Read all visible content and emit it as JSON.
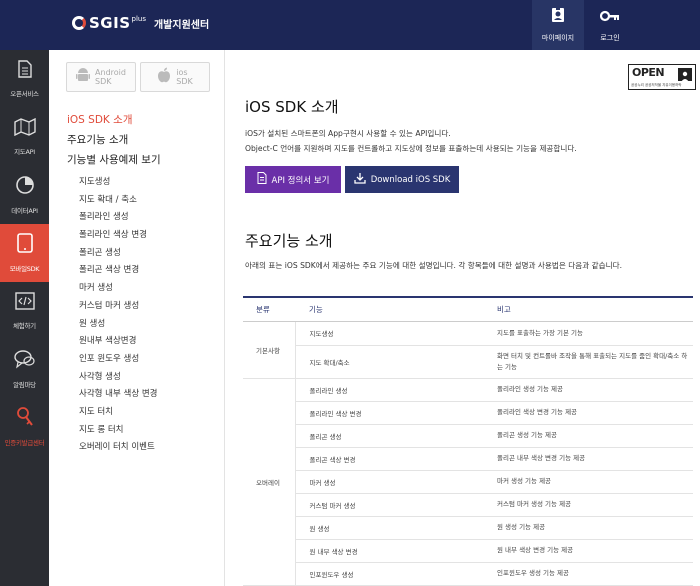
{
  "header": {
    "logo_text": "SGIS",
    "logo_plus": "plus",
    "logo_sub": "개발지원센터",
    "mypage_label": "마이페이지",
    "login_label": "로그인"
  },
  "rail": {
    "items": [
      {
        "label": "오픈서비스",
        "icon": "document-icon"
      },
      {
        "label": "지도API",
        "icon": "map-icon"
      },
      {
        "label": "데이터API",
        "icon": "pie-chart-icon"
      },
      {
        "label": "모바일SDK",
        "icon": "tablet-icon"
      },
      {
        "label": "체험하기",
        "icon": "code-icon"
      },
      {
        "label": "알림마당",
        "icon": "chat-icon"
      },
      {
        "label": "인증키발급센터",
        "icon": "key-icon"
      }
    ]
  },
  "submenu": {
    "android_tab": {
      "line1": "Android",
      "line2": "SDK"
    },
    "ios_tab": {
      "line1": "ios",
      "line2": "SDK"
    },
    "main_items": [
      "iOS SDK 소개",
      "주요기능 소개",
      "기능별 사용예제 보기"
    ],
    "sub_items": [
      "지도생성",
      "지도 확대 / 축소",
      "폴리라인 생성",
      "폴리라인 색상 변경",
      "폴리곤 생성",
      "폴리곤 색상 변경",
      "마커 생성",
      "커스텀 마커 생성",
      "원 생성",
      "원내부 색상변경",
      "인포 윈도우 생성",
      "사각형 생성",
      "사각형 내부 색상 변경",
      "지도 터치",
      "지도 롱 터치",
      "오버레이 터치 이벤트"
    ]
  },
  "main": {
    "open_badge": {
      "text": "OPEN",
      "sub": "공공누리 공공저작물 자유이용허락"
    },
    "title": "iOS SDK 소개",
    "intro_line1": "iOS가 설치된 스마트폰의 App구현시 사용할 수 있는 API입니다.",
    "intro_line2": "Object-C 언어를 지원하며 지도를 컨트롤하고 지도상에 정보를 표출하는데 사용되는 기능을 제공합니다.",
    "api_button": "API 정의서 보기",
    "download_button": "Download iOS SDK",
    "features_title": "주요기능 소개",
    "features_desc": "아래의 표는 iOS SDK에서 제공하는 주요 기능에 대한 설명입니다. 각 항목들에 대한 설명과 사용법은 다음과 같습니다.",
    "table": {
      "headers": [
        "분류",
        "기능",
        "비고"
      ],
      "groups": [
        {
          "category": "기본사항",
          "rows": [
            {
              "feature": "지도생성",
              "desc": "지도를 표출하는 가장 기본 기능"
            },
            {
              "feature": "지도 확대/축소",
              "desc": "화면 터치 및 컨트롤바 조작을 통해 표출되는 지도를 줌인 확대/축소 하는 기능"
            }
          ]
        },
        {
          "category": "오버레이",
          "rows": [
            {
              "feature": "폴리라인 생성",
              "desc": "폴리라인 생성 기능 제공"
            },
            {
              "feature": "폴리라인 색상 변경",
              "desc": "폴리라인 색상 변경 기능 제공"
            },
            {
              "feature": "폴리곤 생성",
              "desc": "폴리곤 생성 기능 제공"
            },
            {
              "feature": "폴리곤 색상 변경",
              "desc": "폴리곤 내부 색상 변경 기능 제공"
            },
            {
              "feature": "마커 생성",
              "desc": "마커 생성 기능 제공"
            },
            {
              "feature": "커스텀 마커 생성",
              "desc": "커스텀 마커 생성 기능 제공"
            },
            {
              "feature": "원 생성",
              "desc": "원 생성 기능 제공"
            },
            {
              "feature": "원 내부 색상 변경",
              "desc": "원 내부 색상 변경 기능 제공"
            },
            {
              "feature": "인포윈도우 생성",
              "desc": "인포윈도우 생성 기능 제공"
            }
          ]
        }
      ]
    }
  },
  "colors": {
    "header_bg": "#1c2656",
    "rail_bg": "#2b2d33",
    "accent_red": "#e04b3a",
    "api_button": "#6a2fa8",
    "download_button": "#2a3570"
  }
}
